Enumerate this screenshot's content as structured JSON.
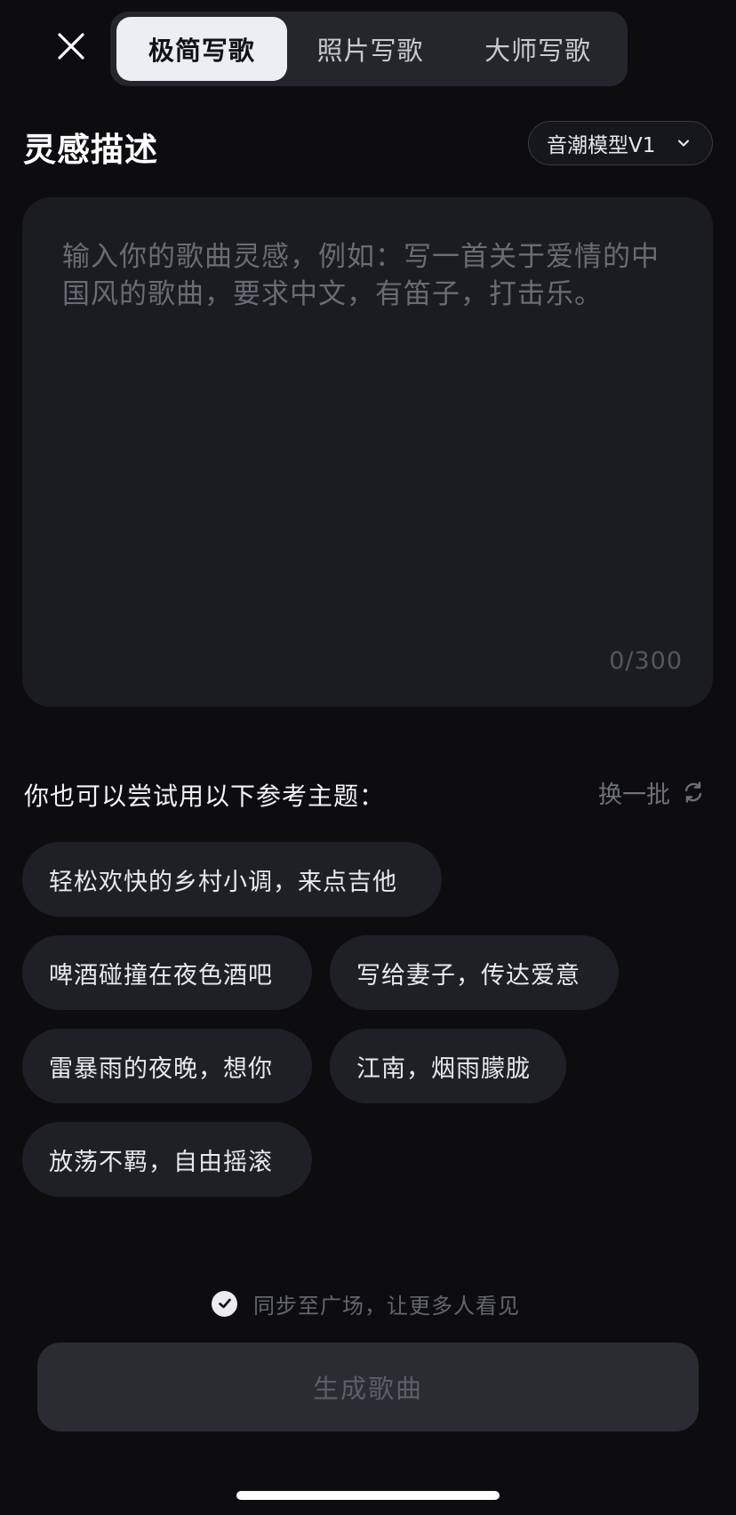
{
  "header": {
    "close_icon": "close-icon",
    "tabs": [
      {
        "label": "极简写歌",
        "active": true
      },
      {
        "label": "照片写歌",
        "active": false
      },
      {
        "label": "大师写歌",
        "active": false
      }
    ]
  },
  "inspiration": {
    "title": "灵感描述",
    "model_select": {
      "value": "音潮模型V1",
      "icon": "chevron-down-icon"
    },
    "textarea": {
      "value": "",
      "placeholder": "输入你的歌曲灵感，例如：写一首关于爱情的中国风的歌曲，要求中文，有笛子，打击乐。",
      "counter": "0/300"
    }
  },
  "suggestions": {
    "header": "你也可以尝试用以下参考主题：",
    "refresh_label": "换一批",
    "refresh_icon": "refresh-icon",
    "chips": [
      "轻松欢快的乡村小调，来点吉他",
      "啤酒碰撞在夜色酒吧",
      "写给妻子，传达爱意",
      "雷暴雨的夜晚，想你",
      "江南，烟雨朦胧",
      "放荡不羁，自由摇滚"
    ]
  },
  "footer": {
    "sync_label": "同步至广场，让更多人看见",
    "sync_checked": true,
    "generate_label": "生成歌曲"
  },
  "colors": {
    "background": "#0d0d10",
    "surface": "#1b1c20",
    "chip": "#1f2025",
    "tab_active_bg": "#eceef3",
    "button_disabled": "#2b2c32"
  }
}
